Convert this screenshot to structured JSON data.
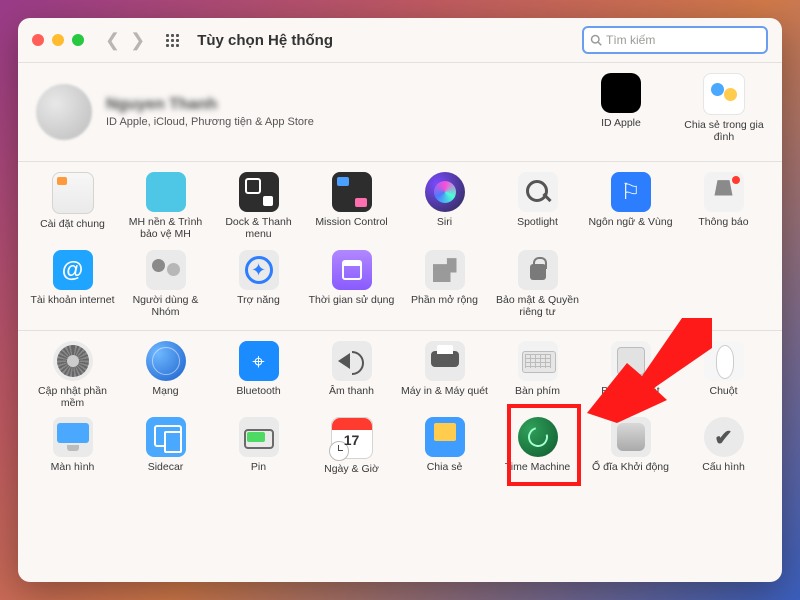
{
  "window": {
    "title": "Tùy chọn Hệ thống"
  },
  "search": {
    "placeholder": "Tìm kiếm"
  },
  "account": {
    "name": "Nguyen Thanh",
    "subtitle": "ID Apple, iCloud, Phương tiện & App Store",
    "right": [
      {
        "id": "appleid",
        "label": "ID Apple"
      },
      {
        "id": "family",
        "label": "Chia sẻ trong gia đình"
      }
    ]
  },
  "group1": [
    {
      "id": "general",
      "label": "Cài đặt chung"
    },
    {
      "id": "desktop",
      "label": "MH nền & Trình bảo vệ MH"
    },
    {
      "id": "dock",
      "label": "Dock & Thanh menu"
    },
    {
      "id": "mission",
      "label": "Mission Control"
    },
    {
      "id": "siri",
      "label": "Siri"
    },
    {
      "id": "spotlight",
      "label": "Spotlight"
    },
    {
      "id": "lang",
      "label": "Ngôn ngữ & Vùng",
      "glyph": "⚐"
    },
    {
      "id": "notif",
      "label": "Thông báo"
    },
    {
      "id": "internet",
      "label": "Tài khoản internet",
      "glyph": "@"
    },
    {
      "id": "users",
      "label": "Người dùng & Nhóm"
    },
    {
      "id": "access",
      "label": "Trợ năng"
    },
    {
      "id": "screentime",
      "label": "Thời gian sử dụng"
    },
    {
      "id": "ext",
      "label": "Phần mở rộng"
    },
    {
      "id": "privacy",
      "label": "Bảo mật & Quyền riêng tư"
    }
  ],
  "group2": [
    {
      "id": "update",
      "label": "Cập nhật phần mềm"
    },
    {
      "id": "network",
      "label": "Mạng"
    },
    {
      "id": "bluetooth",
      "label": "Bluetooth",
      "glyph": "⌖"
    },
    {
      "id": "sound",
      "label": "Âm thanh"
    },
    {
      "id": "printer",
      "label": "Máy in & Máy quét"
    },
    {
      "id": "keyboard",
      "label": "Bàn phím"
    },
    {
      "id": "trackpad",
      "label": "Bàn di chuột"
    },
    {
      "id": "mouse",
      "label": "Chuột"
    },
    {
      "id": "display",
      "label": "Màn hình"
    },
    {
      "id": "sidecar",
      "label": "Sidecar"
    },
    {
      "id": "battery",
      "label": "Pin"
    },
    {
      "id": "date",
      "label": "Ngày & Giờ"
    },
    {
      "id": "sharing",
      "label": "Chia sẻ"
    },
    {
      "id": "tm",
      "label": "Time Machine"
    },
    {
      "id": "startup",
      "label": "Ổ đĩa Khởi động"
    },
    {
      "id": "profiles",
      "label": "Cấu hình"
    }
  ],
  "annotation": {
    "highlighted_item": "keyboard"
  }
}
